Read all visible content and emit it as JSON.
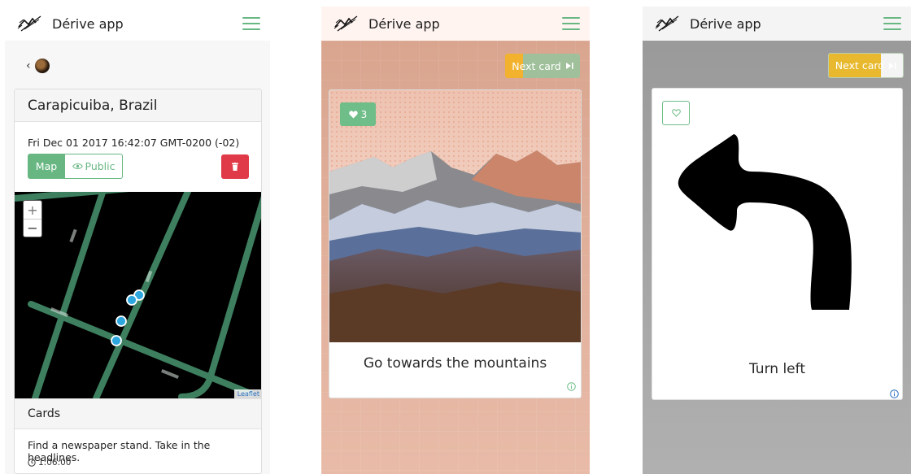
{
  "app": {
    "brand_name": "Dérive app"
  },
  "colors": {
    "accent_green": "#68b783",
    "danger_red": "#e03a48",
    "next_yellow": "#f2b22e",
    "info_blue": "#2a6fbf"
  },
  "screen_derive": {
    "city": "Carapicuiba, Brazil",
    "datetime": "Fri Dec 01 2017 16:42:07 GMT-0200 (-02)",
    "map_label": "Map",
    "public_label": "Public",
    "zoom_in": "+",
    "zoom_out": "−",
    "map_attribution": "Leaflet",
    "cards_heading": "Cards",
    "task_text": "Find a newspaper stand. Take in the headlines.",
    "task_duration": "1:06:00"
  },
  "screen_card_image": {
    "next_label": "Next card",
    "next_progress": 0.24,
    "like_count": "3",
    "card_title": "Go towards the mountains"
  },
  "screen_card_arrow": {
    "next_label": "Next card",
    "next_progress": 0.7,
    "card_title": "Turn left"
  }
}
